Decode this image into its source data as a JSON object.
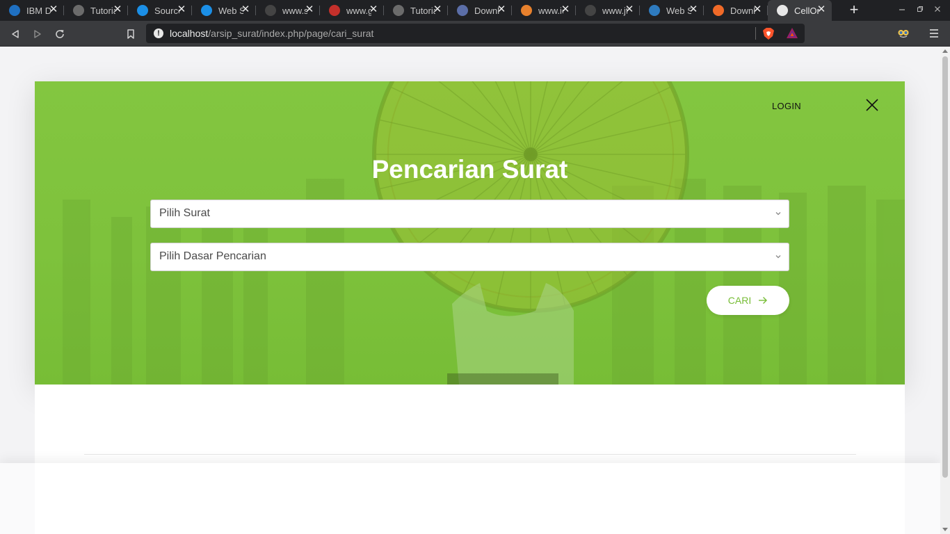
{
  "browser": {
    "tabs": [
      {
        "title": "IBM D",
        "favicon": "infinity-icon",
        "color": "#1f70c1"
      },
      {
        "title": "Tutoria",
        "favicon": "globe-icon",
        "color": "#6b6b6b"
      },
      {
        "title": "Source",
        "favicon": "download-icon",
        "color": "#1b8fe6"
      },
      {
        "title": "Web S",
        "favicon": "download-icon",
        "color": "#1b8fe6"
      },
      {
        "title": "www.s",
        "favicon": "s-logo-icon",
        "color": "#444444"
      },
      {
        "title": "www.g",
        "favicon": "g-logo-icon",
        "color": "#c4302b"
      },
      {
        "title": "Tutoria",
        "favicon": "globe-icon",
        "color": "#6b6b6b"
      },
      {
        "title": "Downl",
        "favicon": "library-icon",
        "color": "#5b6ea8"
      },
      {
        "title": "www.ic",
        "favicon": "cloud-icon",
        "color": "#e8812d"
      },
      {
        "title": "www.jt",
        "favicon": "disc-icon",
        "color": "#444444"
      },
      {
        "title": "Web S",
        "favicon": "code-icon",
        "color": "#2e7bbf"
      },
      {
        "title": "Downl",
        "favicon": "blogger-icon",
        "color": "#f06a28"
      },
      {
        "title": "CellOn",
        "favicon": "globe-icon",
        "color": "#e8e8e8",
        "active": true
      }
    ],
    "close_glyph": "✕",
    "new_tab_glyph": "+",
    "url_host": "localhost",
    "url_path": "/arsip_surat/index.php/page/cari_surat",
    "info_glyph": "!"
  },
  "page": {
    "login_label": "LOGIN",
    "title": "Pencarian Surat",
    "select_surat": "Pilih Surat",
    "select_dasar": "Pilih Dasar Pencarian",
    "search_button": "CARI",
    "accent_color": "#77bd36"
  }
}
